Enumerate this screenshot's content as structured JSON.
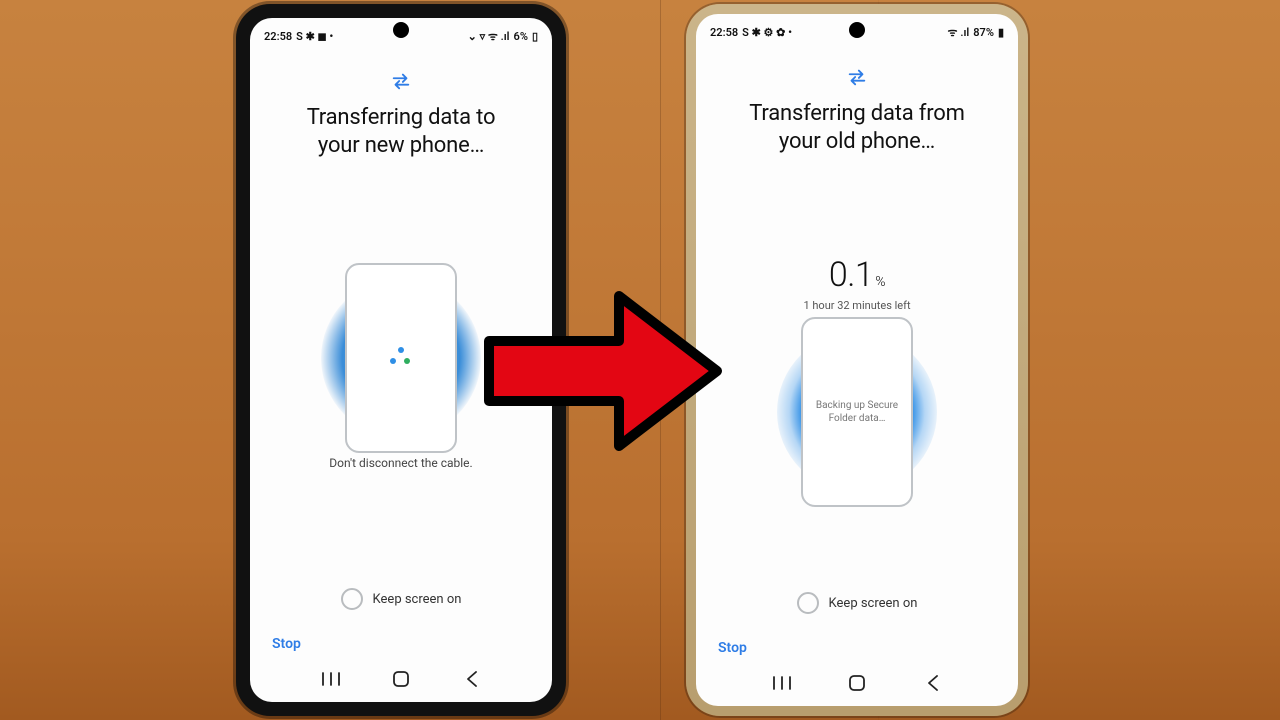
{
  "left": {
    "status": {
      "time": "22:58",
      "indicators_left": "S ✱ ◼︎ •",
      "indicators_right": "⌄ ▿ ᯤ .ıl",
      "battery": "6%"
    },
    "title_line1": "Transferring data to",
    "title_line2": "your new phone…",
    "caption": "Don't disconnect the cable.",
    "keep_screen": "Keep screen on",
    "stop": "Stop"
  },
  "right": {
    "status": {
      "time": "22:58",
      "indicators_left": "S ✱ ⚙ ✿ •",
      "indicators_right": "ᯤ .ıl",
      "battery": "87%"
    },
    "title_line1": "Transferring data from",
    "title_line2": "your old phone…",
    "progress_value": "0.1",
    "progress_unit": "%",
    "time_left": "1 hour 32 minutes left",
    "backup_text": "Backing up Secure Folder data…",
    "keep_screen": "Keep screen on",
    "stop": "Stop"
  }
}
